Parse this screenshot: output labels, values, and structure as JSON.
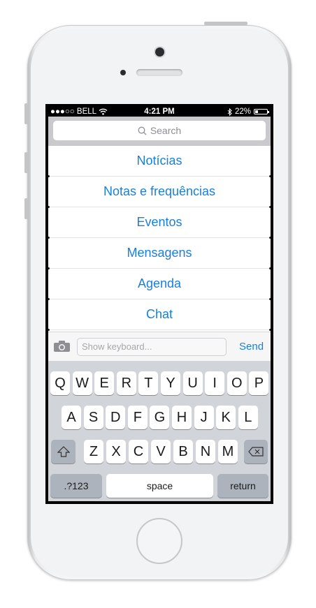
{
  "status_bar": {
    "carrier": "●●●○○ BELL",
    "time": "4:21 PM",
    "battery": "22%",
    "battery_level": 0.22
  },
  "search": {
    "placeholder": "Search"
  },
  "menu": {
    "items": [
      "Notícias",
      "Notas e frequências",
      "Eventos",
      "Mensagens",
      "Agenda",
      "Chat"
    ]
  },
  "composer": {
    "placeholder": "Show keyboard...",
    "send_label": "Send"
  },
  "keyboard": {
    "row1": [
      "Q",
      "W",
      "E",
      "R",
      "T",
      "Y",
      "U",
      "I",
      "O",
      "P"
    ],
    "row2": [
      "A",
      "S",
      "D",
      "F",
      "G",
      "H",
      "J",
      "K",
      "L"
    ],
    "row3": [
      "Z",
      "X",
      "C",
      "V",
      "B",
      "N",
      "M"
    ],
    "numbers_label": ".?123",
    "space_label": "space",
    "return_label": "return"
  },
  "colors": {
    "accent": "#1a7fd9",
    "keyboard_bg": "#d1d4d8",
    "search_bar_bg": "#c9c9ce"
  }
}
